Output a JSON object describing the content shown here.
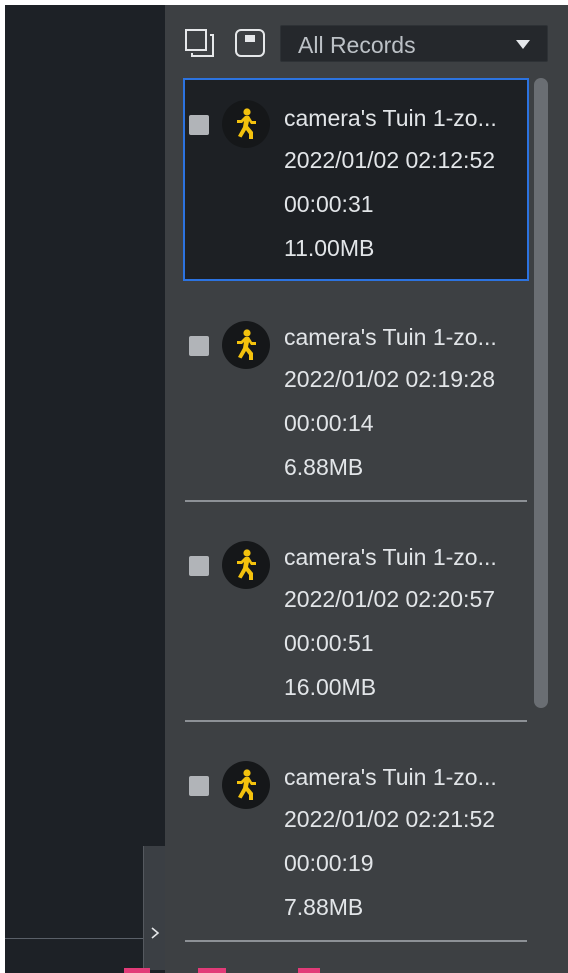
{
  "toolbar": {
    "select_all_icon": "select-all-icon",
    "sd_card_icon": "sd-card-icon",
    "filter": {
      "selected": "All Records"
    }
  },
  "records": [
    {
      "title": "camera's Tuin 1-zo...",
      "datetime": "2022/01/02 02:12:52",
      "duration": "00:00:31",
      "size": "11.00MB",
      "selected": true,
      "icon": "person-walking-icon"
    },
    {
      "title": "camera's Tuin 1-zo...",
      "datetime": "2022/01/02 02:19:28",
      "duration": "00:00:14",
      "size": "6.88MB",
      "selected": false,
      "icon": "person-walking-icon"
    },
    {
      "title": "camera's Tuin 1-zo...",
      "datetime": "2022/01/02 02:20:57",
      "duration": "00:00:51",
      "size": "16.00MB",
      "selected": false,
      "icon": "person-walking-icon"
    },
    {
      "title": "camera's Tuin 1-zo...",
      "datetime": "2022/01/02 02:21:52",
      "duration": "00:00:19",
      "size": "7.88MB",
      "selected": false,
      "icon": "person-walking-icon"
    }
  ],
  "colors": {
    "accent": "#2c73e0",
    "motion_icon": "#f4c20d",
    "panel_bg": "#3d4043",
    "left_bg": "#1d2126"
  }
}
